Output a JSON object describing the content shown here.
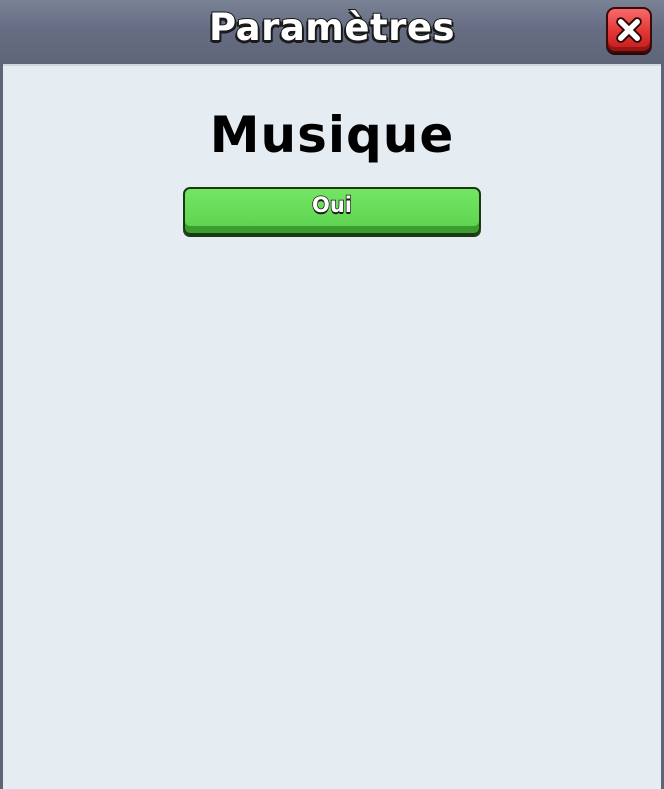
{
  "window": {
    "title": "Paramètres",
    "close_icon": "close-x-icon"
  },
  "settings": {
    "section_title": "Musique",
    "toggle_label": "Oui"
  },
  "colors": {
    "title_bar": "#666d82",
    "panel_bg": "#e5edf3",
    "close_button": "#e23535",
    "toggle_button": "#65da56"
  }
}
